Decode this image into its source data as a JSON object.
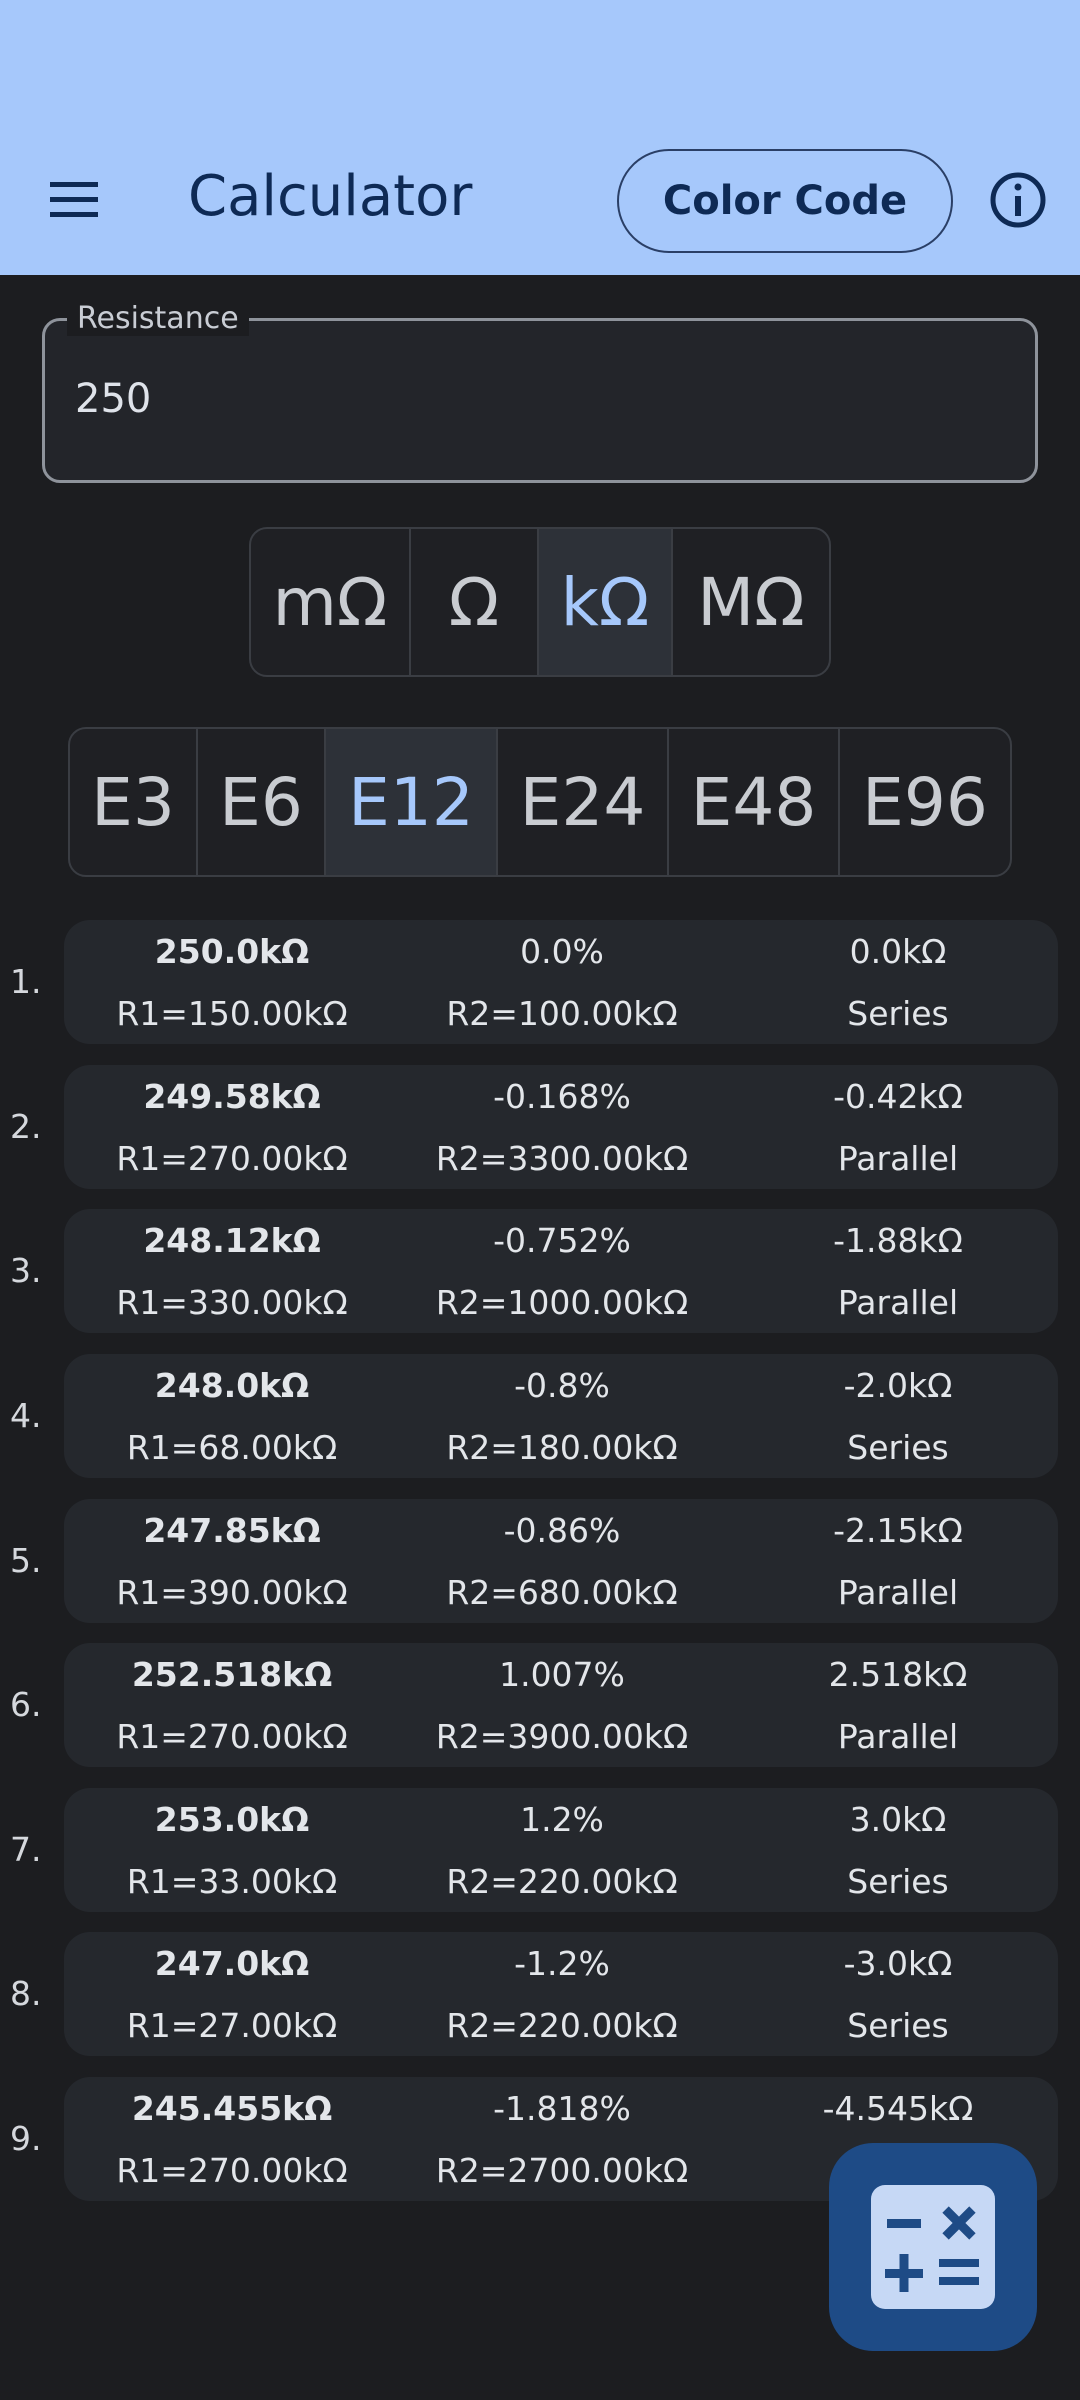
{
  "app_bar": {
    "title": "Calculator",
    "color_code_label": "Color Code",
    "menu_icon": "menu-icon",
    "info_icon": "info-icon"
  },
  "resistance_field": {
    "label": "Resistance",
    "value": "250"
  },
  "units": {
    "options": [
      "mΩ",
      "Ω",
      "kΩ",
      "MΩ"
    ],
    "selected": "kΩ"
  },
  "eseries": {
    "options": [
      "E3",
      "E6",
      "E12",
      "E24",
      "E48",
      "E96"
    ],
    "selected": "E12"
  },
  "results": [
    {
      "index": "1.",
      "total": "250.0kΩ",
      "error_pct": "0.0%",
      "error_abs": "0.0kΩ",
      "r1": "R1=150.00kΩ",
      "r2": "R2=100.00kΩ",
      "config": "Series"
    },
    {
      "index": "2.",
      "total": "249.58kΩ",
      "error_pct": "-0.168%",
      "error_abs": "-0.42kΩ",
      "r1": "R1=270.00kΩ",
      "r2": "R2=3300.00kΩ",
      "config": "Parallel"
    },
    {
      "index": "3.",
      "total": "248.12kΩ",
      "error_pct": "-0.752%",
      "error_abs": "-1.88kΩ",
      "r1": "R1=330.00kΩ",
      "r2": "R2=1000.00kΩ",
      "config": "Parallel"
    },
    {
      "index": "4.",
      "total": "248.0kΩ",
      "error_pct": "-0.8%",
      "error_abs": "-2.0kΩ",
      "r1": "R1=68.00kΩ",
      "r2": "R2=180.00kΩ",
      "config": "Series"
    },
    {
      "index": "5.",
      "total": "247.85kΩ",
      "error_pct": "-0.86%",
      "error_abs": "-2.15kΩ",
      "r1": "R1=390.00kΩ",
      "r2": "R2=680.00kΩ",
      "config": "Parallel"
    },
    {
      "index": "6.",
      "total": "252.518kΩ",
      "error_pct": "1.007%",
      "error_abs": "2.518kΩ",
      "r1": "R1=270.00kΩ",
      "r2": "R2=3900.00kΩ",
      "config": "Parallel"
    },
    {
      "index": "7.",
      "total": "253.0kΩ",
      "error_pct": "1.2%",
      "error_abs": "3.0kΩ",
      "r1": "R1=33.00kΩ",
      "r2": "R2=220.00kΩ",
      "config": "Series"
    },
    {
      "index": "8.",
      "total": "247.0kΩ",
      "error_pct": "-1.2%",
      "error_abs": "-3.0kΩ",
      "r1": "R1=27.00kΩ",
      "r2": "R2=220.00kΩ",
      "config": "Series"
    },
    {
      "index": "9.",
      "total": "245.455kΩ",
      "error_pct": "-1.818%",
      "error_abs": "-4.545kΩ",
      "r1": "R1=270.00kΩ",
      "r2": "R2=2700.00kΩ",
      "config": ""
    }
  ],
  "fab": {
    "icon": "calculator-icon"
  },
  "colors": {
    "app_bar": "#a6c8fb",
    "background": "#1c1d20",
    "card": "#25282d",
    "accent": "#a6c8fb",
    "fab": "#1e4b86"
  }
}
